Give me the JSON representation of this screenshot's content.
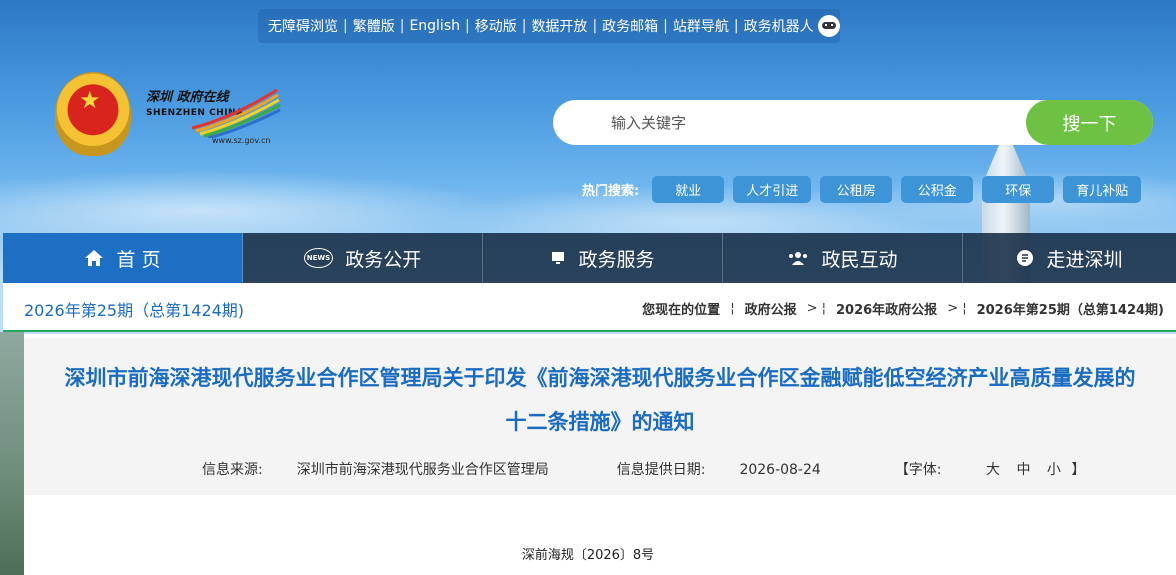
{
  "topbar": {
    "links": [
      "无障碍浏览",
      "繁體版",
      "English",
      "移动版",
      "数据开放",
      "政务邮箱",
      "站群导航",
      "政务机器人"
    ],
    "robot_icon": "robot-icon"
  },
  "logo": {
    "cn": "深圳 政府在线",
    "en": "SHENZHEN CHINA",
    "url": "www.sz.gov.cn"
  },
  "search": {
    "placeholder": "输入关键字",
    "button": "搜一下"
  },
  "hot": {
    "label": "热门搜索:",
    "tags": [
      "就业",
      "人才引进",
      "公租房",
      "公积金",
      "环保",
      "育儿补贴"
    ]
  },
  "nav": {
    "items": [
      {
        "label": "首 页",
        "icon": "home-icon"
      },
      {
        "label": "政务公开",
        "icon": "news-icon"
      },
      {
        "label": "政务服务",
        "icon": "monitor-icon"
      },
      {
        "label": "政民互动",
        "icon": "people-icon"
      },
      {
        "label": "走进深圳",
        "icon": "shield-icon"
      }
    ]
  },
  "breadcrumb": {
    "issue": "2026年第25期（总第1424期)",
    "location_label": "您现在的位置",
    "items": [
      "政府公报",
      "2026年政府公报",
      "2026年第25期（总第1424期)"
    ]
  },
  "article": {
    "title_line1": "深圳市前海深港现代服务业合作区管理局关于印发《前海深港现代服务业合作区金融赋能低空经济产业高质量发展的",
    "title_line2": "十二条措施》的通知",
    "source_label": "信息来源:",
    "source": "深圳市前海深港现代服务业合作区管理局",
    "date_label": "信息提供日期:",
    "date": "2026-08-24",
    "font_label": "【字体:",
    "font_big": "大",
    "font_mid": "中",
    "font_small": "小",
    "font_close": "】",
    "doc_no": "深前海规〔2026〕8号"
  },
  "colors": {
    "accent_blue": "#1c6fc2",
    "search_green": "#6fc144",
    "divider_green": "#2ba361"
  }
}
